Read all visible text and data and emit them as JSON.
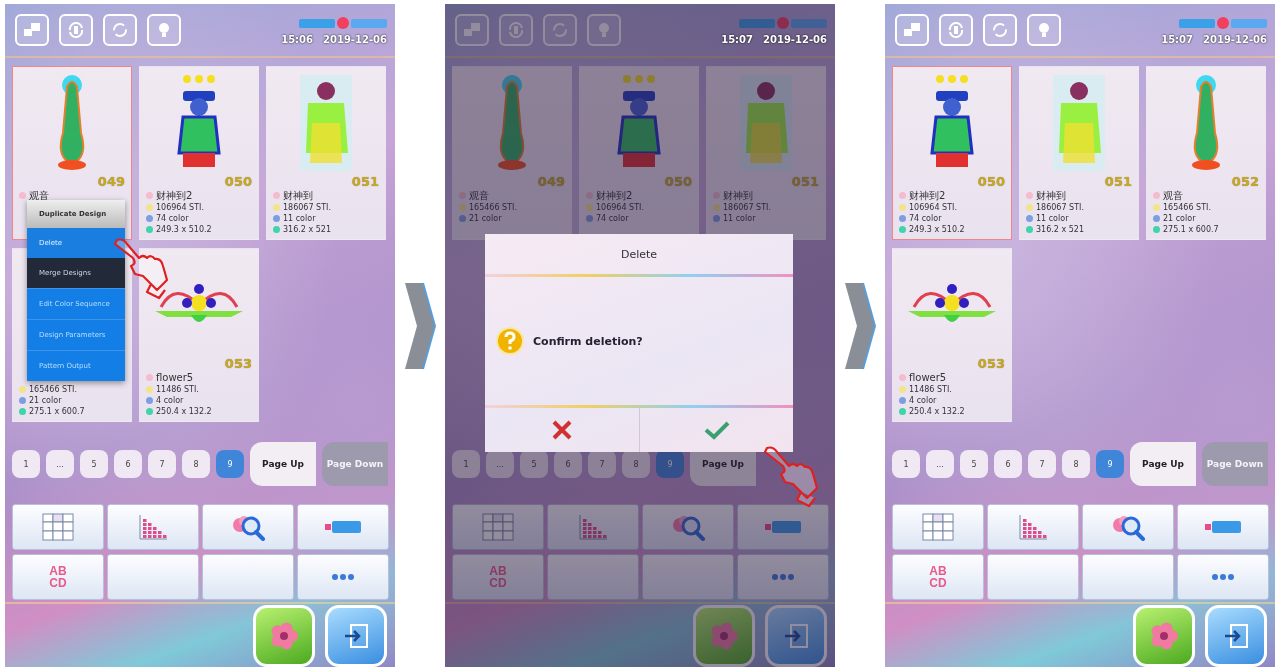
{
  "panels": [
    {
      "dimmed": false,
      "time": "15:06",
      "date": "2019-12-06",
      "cards": [
        {
          "number": "049",
          "kind": "standing",
          "selected": true,
          "lines": [
            {
              "kind": "name",
              "text": "观音"
            }
          ]
        },
        {
          "number": "050",
          "kind": "robed",
          "selected": false,
          "lines": [
            {
              "kind": "name",
              "text": "财神到2"
            },
            {
              "kind": "stitches",
              "text": "106964 STI."
            },
            {
              "kind": "colors",
              "text": "74 color"
            },
            {
              "kind": "size",
              "text": "249.3 x 510.2"
            }
          ]
        },
        {
          "number": "051",
          "kind": "boxed",
          "selected": false,
          "lines": [
            {
              "kind": "name",
              "text": "财神到"
            },
            {
              "kind": "stitches",
              "text": "186067 STI."
            },
            {
              "kind": "colors",
              "text": "11 color"
            },
            {
              "kind": "size",
              "text": "316.2 x 521"
            }
          ]
        },
        {
          "kind": "hidden",
          "selected": false,
          "lines": [
            {
              "kind": "stitches",
              "text": "165466 STI."
            },
            {
              "kind": "colors",
              "text": "21 color"
            },
            {
              "kind": "size",
              "text": "275.1 x 600.7"
            }
          ]
        },
        {
          "number": "053",
          "kind": "flower",
          "selected": false,
          "lines": [
            {
              "kind": "name",
              "text": "flower5"
            },
            {
              "kind": "stitches",
              "text": "11486 STI."
            },
            {
              "kind": "colors",
              "text": "4 color"
            },
            {
              "kind": "size",
              "text": "250.4 x 132.2"
            }
          ]
        }
      ],
      "menu": [
        {
          "label": "Duplicate Design",
          "kind": "grey"
        },
        {
          "label": "Delete",
          "kind": "light"
        },
        {
          "label": "Merge Designs",
          "kind": "dark"
        },
        {
          "label": "Edit Color Sequence",
          "kind": "blue"
        },
        {
          "label": "Design Parameters",
          "kind": "blue"
        },
        {
          "label": "Pattern Output",
          "kind": "blue"
        }
      ],
      "pages": [
        {
          "label": "1",
          "selected": false
        },
        {
          "label": "...",
          "selected": false
        },
        {
          "label": "5",
          "selected": false
        },
        {
          "label": "6",
          "selected": false
        },
        {
          "label": "7",
          "selected": false
        },
        {
          "label": "8",
          "selected": false
        },
        {
          "label": "9",
          "selected": true
        }
      ],
      "page_up": {
        "label": "Page Up",
        "disabled": false
      },
      "page_down": {
        "label": "Page Down",
        "disabled": true
      },
      "letters": "ABCD"
    },
    {
      "dimmed": true,
      "time": "15:07",
      "date": "2019-12-06",
      "cards": [
        {
          "number": "049",
          "kind": "standing",
          "selected": false,
          "lines": [
            {
              "kind": "name",
              "text": "观音"
            },
            {
              "kind": "stitches",
              "text": "165466 STI."
            },
            {
              "kind": "colors",
              "text": "21 color"
            }
          ]
        },
        {
          "number": "050",
          "kind": "robed",
          "selected": false,
          "lines": [
            {
              "kind": "name",
              "text": "财神到2"
            },
            {
              "kind": "stitches",
              "text": "106964 STI."
            },
            {
              "kind": "colors",
              "text": "74 color"
            }
          ]
        },
        {
          "number": "051",
          "kind": "boxed",
          "selected": false,
          "lines": [
            {
              "kind": "name",
              "text": "财神到"
            },
            {
              "kind": "stitches",
              "text": "186067 STI."
            },
            {
              "kind": "colors",
              "text": "11 color"
            }
          ]
        }
      ],
      "dialog": {
        "title": "Delete",
        "message": "Confirm deletion?"
      },
      "pages": [
        {
          "label": "1",
          "selected": false
        },
        {
          "label": "...",
          "selected": false
        },
        {
          "label": "5",
          "selected": false
        },
        {
          "label": "6",
          "selected": false
        },
        {
          "label": "7",
          "selected": false
        },
        {
          "label": "8",
          "selected": false
        },
        {
          "label": "9",
          "selected": true
        }
      ],
      "page_up": {
        "label": "Page Up",
        "disabled": false
      },
      "letters": "ABCD"
    },
    {
      "dimmed": false,
      "time": "15:07",
      "date": "2019-12-06",
      "cards": [
        {
          "number": "050",
          "kind": "robed",
          "selected": true,
          "lines": [
            {
              "kind": "name",
              "text": "财神到2"
            },
            {
              "kind": "stitches",
              "text": "106964 STI."
            },
            {
              "kind": "colors",
              "text": "74 color"
            },
            {
              "kind": "size",
              "text": "249.3 x 510.2"
            }
          ]
        },
        {
          "number": "051",
          "kind": "boxed",
          "selected": false,
          "lines": [
            {
              "kind": "name",
              "text": "财神到"
            },
            {
              "kind": "stitches",
              "text": "186067 STI."
            },
            {
              "kind": "colors",
              "text": "11 color"
            },
            {
              "kind": "size",
              "text": "316.2 x 521"
            }
          ]
        },
        {
          "number": "052",
          "kind": "standing",
          "selected": false,
          "lines": [
            {
              "kind": "name",
              "text": "观音"
            },
            {
              "kind": "stitches",
              "text": "165466 STI."
            },
            {
              "kind": "colors",
              "text": "21 color"
            },
            {
              "kind": "size",
              "text": "275.1 x 600.7"
            }
          ]
        },
        {
          "number": "053",
          "kind": "flower",
          "selected": false,
          "lines": [
            {
              "kind": "name",
              "text": "flower5"
            },
            {
              "kind": "stitches",
              "text": "11486 STI."
            },
            {
              "kind": "colors",
              "text": "4 color"
            },
            {
              "kind": "size",
              "text": "250.4 x 132.2"
            }
          ]
        }
      ],
      "pages": [
        {
          "label": "1",
          "selected": false
        },
        {
          "label": "...",
          "selected": false
        },
        {
          "label": "5",
          "selected": false
        },
        {
          "label": "6",
          "selected": false
        },
        {
          "label": "7",
          "selected": false
        },
        {
          "label": "8",
          "selected": false
        },
        {
          "label": "9",
          "selected": true
        }
      ],
      "page_up": {
        "label": "Page Up",
        "disabled": false
      },
      "page_down": {
        "label": "Page Down",
        "disabled": true
      },
      "letters": "ABCD"
    }
  ]
}
